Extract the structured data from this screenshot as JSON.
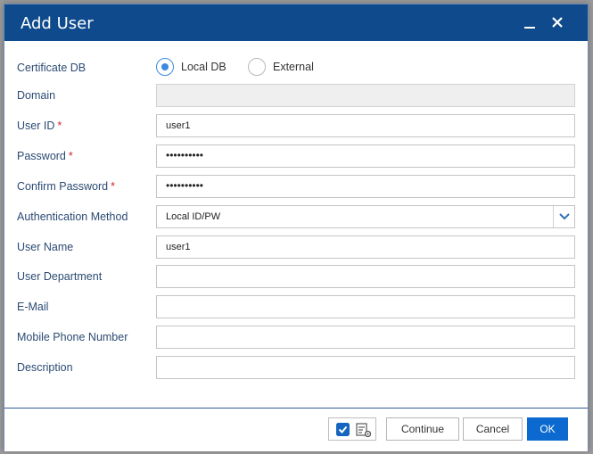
{
  "dialog": {
    "title": "Add User",
    "minimize_icon": "minimize-icon",
    "close_icon": "close-icon"
  },
  "form": {
    "certificate_db": {
      "label": "Certificate DB",
      "options": [
        {
          "label": "Local DB",
          "selected": true
        },
        {
          "label": "External",
          "selected": false
        }
      ]
    },
    "domain": {
      "label": "Domain",
      "value": "",
      "disabled": true
    },
    "user_id": {
      "label": "User ID",
      "required_mark": "*",
      "value": "user1"
    },
    "password": {
      "label": "Password",
      "required_mark": "*",
      "value": "••••••••••"
    },
    "confirm_password": {
      "label": "Confirm Password",
      "required_mark": "*",
      "value": "••••••••••"
    },
    "auth_method": {
      "label": "Authentication Method",
      "value": "Local ID/PW"
    },
    "user_name": {
      "label": "User Name",
      "value": "user1"
    },
    "user_department": {
      "label": "User Department",
      "value": ""
    },
    "email": {
      "label": "E-Mail",
      "value": ""
    },
    "mobile": {
      "label": "Mobile Phone Number",
      "value": ""
    },
    "description": {
      "label": "Description",
      "value": ""
    }
  },
  "footer": {
    "continue_label": "Continue",
    "cancel_label": "Cancel",
    "ok_label": "OK",
    "checkbox_checked": true,
    "icons": [
      "checkbox-icon",
      "list-settings-icon"
    ]
  },
  "colors": {
    "titlebar": "#0e4a8c",
    "label": "#2b4a73",
    "required": "#d0262d",
    "accent": "#0b69cf"
  }
}
